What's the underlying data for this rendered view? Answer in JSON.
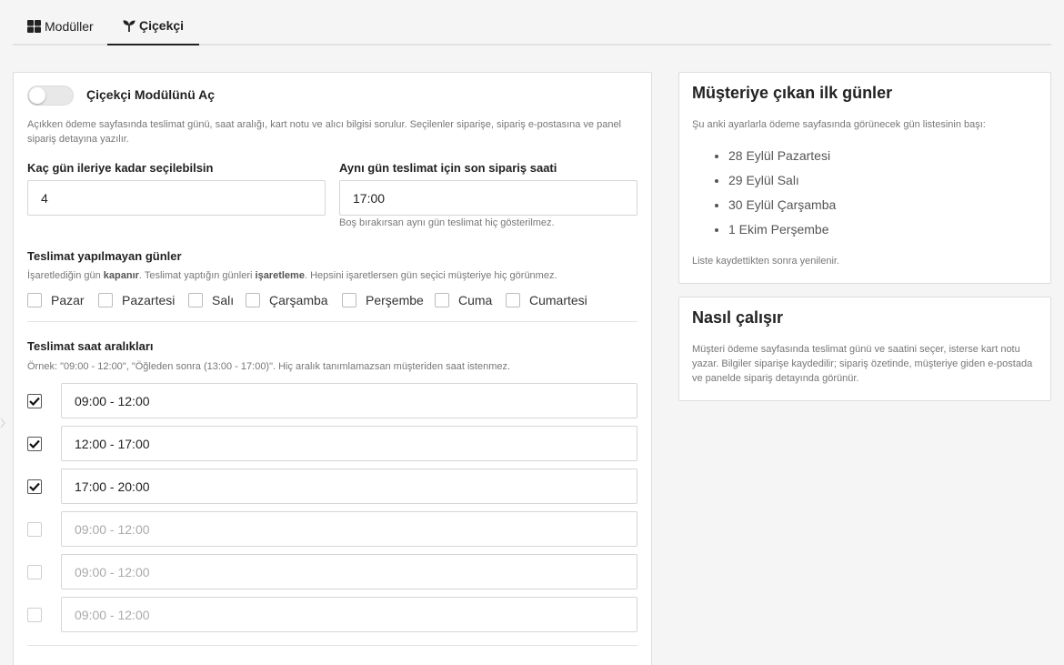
{
  "tabs": [
    {
      "label": "Modüller",
      "icon": "grid-icon"
    },
    {
      "label": "Çiçekçi",
      "icon": "seedling-icon",
      "active": true
    }
  ],
  "module": {
    "toggle_label": "Çiçekçi Modülünü Aç",
    "enabled": false,
    "description": "Açıkken ödeme sayfasında teslimat günü, saat aralığı, kart notu ve alıcı bilgisi sorulur. Seçilenler siparişe, sipariş e-postasına ve panel sipariş detayına yazılır."
  },
  "days_ahead": {
    "label": "Kaç gün ileriye kadar seçilebilsin",
    "value": "4"
  },
  "same_day": {
    "label": "Aynı gün teslimat için son sipariş saati",
    "value": "17:00",
    "help": "Boş bırakırsan aynı gün teslimat hiç gösterilmez."
  },
  "closed_days": {
    "label": "Teslimat yapılmayan günler",
    "help_prefix": "İşaretlediğin gün ",
    "help_bold1": "kapanır",
    "help_mid": ". Teslimat yaptığın günleri ",
    "help_bold2": "işaretleme",
    "help_suffix": ". Hepsini işaretlersen gün seçici müşteriye hiç görünmez.",
    "days": [
      {
        "label": "Pazar",
        "checked": false
      },
      {
        "label": "Pazartesi",
        "checked": false
      },
      {
        "label": "Salı",
        "checked": false
      },
      {
        "label": "Çarşamba",
        "checked": false
      },
      {
        "label": "Perşembe",
        "checked": false
      },
      {
        "label": "Cuma",
        "checked": false
      },
      {
        "label": "Cumartesi",
        "checked": false
      }
    ]
  },
  "time_slots": {
    "label": "Teslimat saat aralıkları",
    "help": "Örnek: \"09:00 - 12:00\", \"Öğleden sonra (13:00 - 17:00)\". Hiç aralık tanımlamazsan müşteriden saat istenmez.",
    "slots": [
      {
        "value": "09:00 - 12:00",
        "placeholder": "09:00 - 12:00",
        "checked": true
      },
      {
        "value": "12:00 - 17:00",
        "placeholder": "09:00 - 12:00",
        "checked": true
      },
      {
        "value": "17:00 - 20:00",
        "placeholder": "09:00 - 12:00",
        "checked": true
      },
      {
        "value": "",
        "placeholder": "09:00 - 12:00",
        "checked": false
      },
      {
        "value": "",
        "placeholder": "09:00 - 12:00",
        "checked": false
      },
      {
        "value": "",
        "placeholder": "09:00 - 12:00",
        "checked": false
      }
    ]
  },
  "preview": {
    "title": "Müşteriye çıkan ilk günler",
    "help": "Şu anki ayarlarla ödeme sayfasında görünecek gün listesinin başı:",
    "days": [
      "28 Eylül Pazartesi",
      "29 Eylül Salı",
      "30 Eylül Çarşamba",
      "1 Ekim Perşembe"
    ],
    "footer": "Liste kaydettikten sonra yenilenir."
  },
  "how": {
    "title": "Nasıl çalışır",
    "text": "Müşteri ödeme sayfasında teslimat günü ve saatini seçer, isterse kart notu yazar. Bilgiler siparişe kaydedilir; sipariş özetinde, müşteriye giden e-postada ve panelde sipariş detayında görünür."
  }
}
